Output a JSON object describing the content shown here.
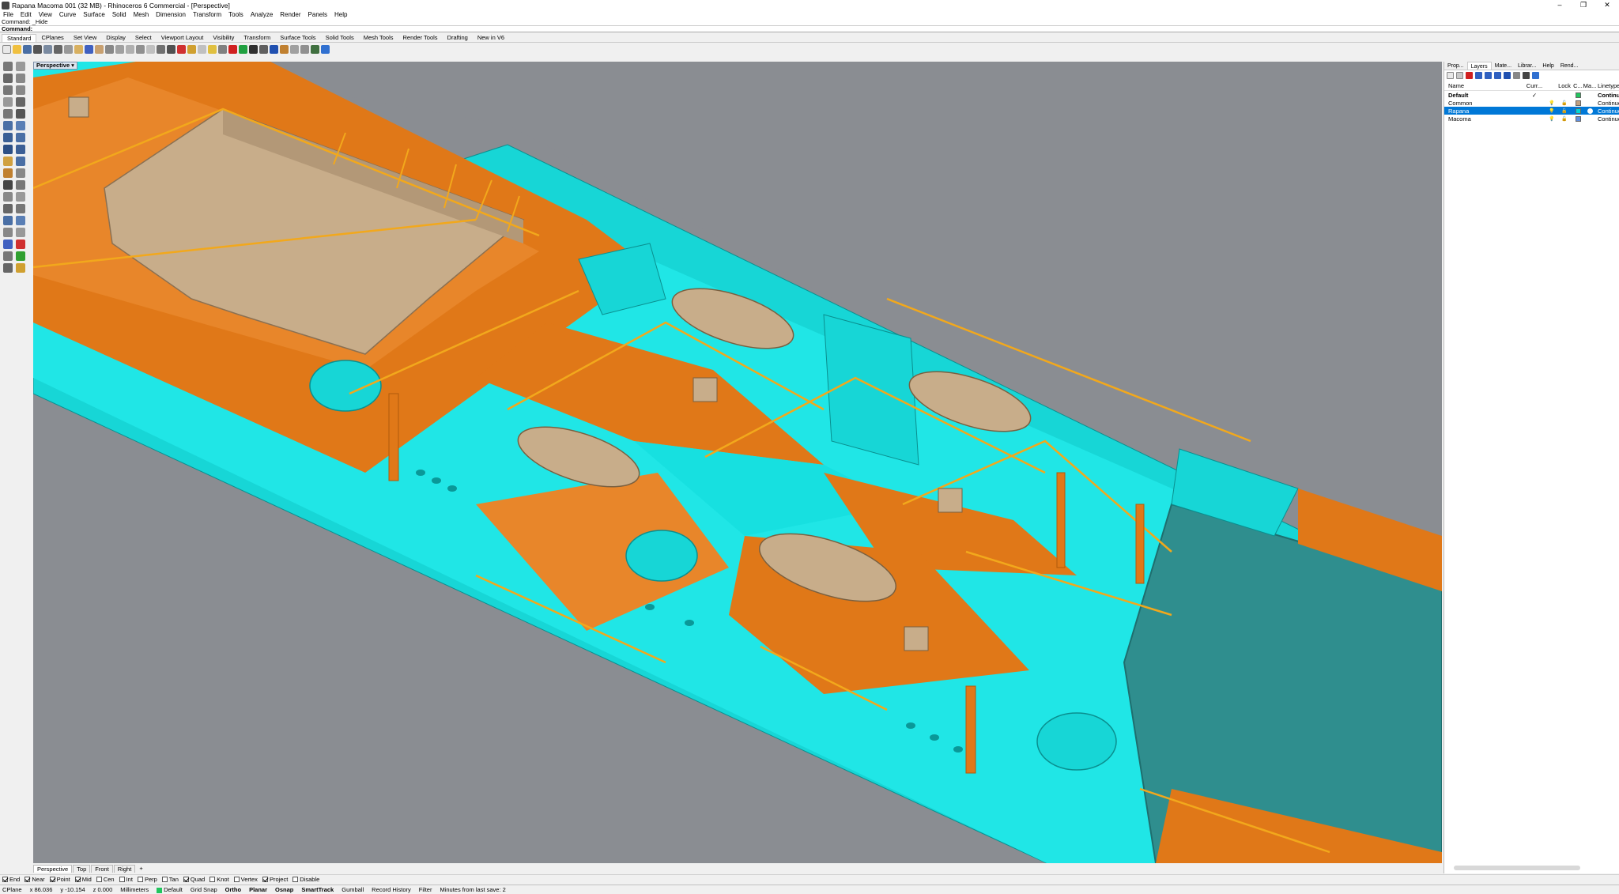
{
  "window": {
    "title": "Rapana Macoma 001 (32 MB) - Rhinoceros 6 Commercial - [Perspective]",
    "minimize": "–",
    "maximize": "❐",
    "close": "✕"
  },
  "menu": [
    "File",
    "Edit",
    "View",
    "Curve",
    "Surface",
    "Solid",
    "Mesh",
    "Dimension",
    "Transform",
    "Tools",
    "Analyze",
    "Render",
    "Panels",
    "Help"
  ],
  "command": {
    "history": "Command: _Hide",
    "prompt": "Command:"
  },
  "toolbar_tabs": [
    "Standard",
    "CPlanes",
    "Set View",
    "Display",
    "Select",
    "Viewport Layout",
    "Visibility",
    "Transform",
    "Surface Tools",
    "Solid Tools",
    "Mesh Tools",
    "Render Tools",
    "Drafting",
    "New in V6"
  ],
  "viewport": {
    "label": "Perspective",
    "arrow": "▾",
    "tabs": [
      "Perspective",
      "Top",
      "Front",
      "Right"
    ],
    "add_tab": "+"
  },
  "osnaps": [
    {
      "label": "End",
      "on": true
    },
    {
      "label": "Near",
      "on": true
    },
    {
      "label": "Point",
      "on": true
    },
    {
      "label": "Mid",
      "on": true
    },
    {
      "label": "Cen",
      "on": false
    },
    {
      "label": "Int",
      "on": false
    },
    {
      "label": "Perp",
      "on": false
    },
    {
      "label": "Tan",
      "on": false
    },
    {
      "label": "Quad",
      "on": true
    },
    {
      "label": "Knot",
      "on": false
    },
    {
      "label": "Vertex",
      "on": false
    },
    {
      "label": "Project",
      "on": true
    },
    {
      "label": "Disable",
      "on": false
    }
  ],
  "status": {
    "cplane": "CPlane",
    "x": "x 86.036",
    "y": "y -10.154",
    "z": "z 0.000",
    "units": "Millimeters",
    "layer": "Default",
    "toggles": [
      "Grid Snap",
      "Ortho",
      "Planar",
      "Osnap",
      "SmartTrack",
      "Gumball",
      "Record History",
      "Filter"
    ],
    "save_note": "Minutes from last save: 2"
  },
  "panel": {
    "tabs": [
      "Prop...",
      "Layers",
      "Mate...",
      "Librar...",
      "Help",
      "Rend..."
    ],
    "active_tab": "Layers",
    "headers": {
      "name": "Name",
      "current": "Curr...",
      "lock": "Lock",
      "color": "C...",
      "material": "Ma...",
      "linetype": "Linetype"
    },
    "layers": [
      {
        "name": "Default",
        "current": "✓",
        "color": "#22c55e",
        "linetype": "Continuous",
        "bold": true,
        "selected": false,
        "on": "",
        "lock": ""
      },
      {
        "name": "Common",
        "current": "",
        "color": "#c0a080",
        "linetype": "Continuous",
        "bold": false,
        "selected": false,
        "on": "💡",
        "lock": "🔓"
      },
      {
        "name": "Rapana",
        "current": "",
        "color": "#00d8d8",
        "linetype": "Continuous",
        "bold": false,
        "selected": true,
        "on": "💡",
        "lock": "🔓"
      },
      {
        "name": "Macoma",
        "current": "",
        "color": "#6090e0",
        "linetype": "Continuous",
        "bold": false,
        "selected": false,
        "on": "💡",
        "lock": "🔓"
      }
    ]
  },
  "colors": {
    "hull": "#17d6d6",
    "deck": "#e07818",
    "rail": "#f2a81c",
    "boat": "#c8ad8a",
    "dark_hull": "#2f8e8e",
    "background": "#8a8d92"
  }
}
